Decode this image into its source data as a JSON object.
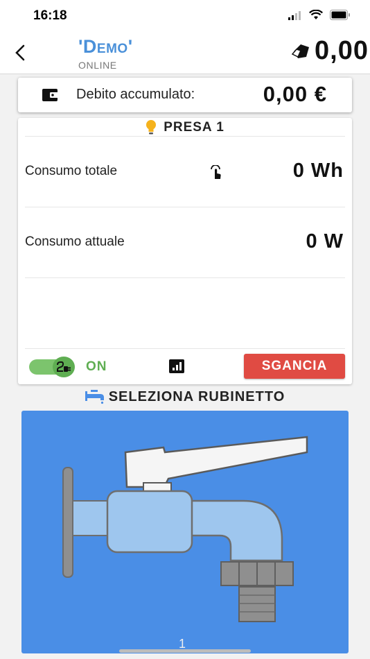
{
  "status_bar": {
    "time": "16:18"
  },
  "header": {
    "device_name": "'Demo'",
    "device_status": "ONLINE",
    "balance": "0,00"
  },
  "debit": {
    "label": "Debito accumulato:",
    "value": "0,00 €"
  },
  "presa": {
    "title": "PRESA 1",
    "rows": [
      {
        "label": "Consumo totale",
        "value": "0 Wh"
      },
      {
        "label": "Consumo attuale",
        "value": "0 W"
      }
    ],
    "toggle_label": "ON",
    "toggle_on": true,
    "release_button": "SGANCIA"
  },
  "faucet_section": {
    "title": "SELEZIONA RUBINETTO",
    "page": "1"
  },
  "colors": {
    "accent": "#4a90d9",
    "panel": "#4a8ee6",
    "danger": "#e04b43",
    "on": "#5fae52"
  }
}
